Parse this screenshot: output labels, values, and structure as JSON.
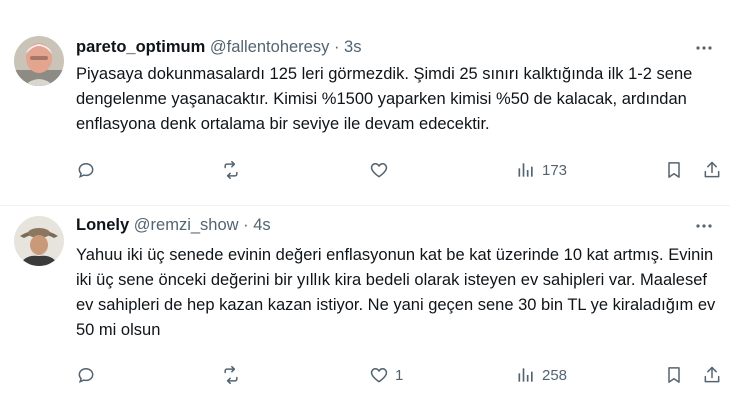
{
  "tweets": [
    {
      "name": "pareto_optimum",
      "handle": "@fallentoheresy",
      "separator": "·",
      "time": "3s",
      "text": "Piyasaya dokunmasalardı 125 leri görmezdik. Şimdi 25 sınırı kalktığında ilk 1-2 sene dengelenme yaşanacaktır. Kimisi %1500 yaparken kimisi %50 de kalacak, ardından enflasyona denk ortalama bir seviye ile devam edecektir.",
      "likes": "",
      "views": "173"
    },
    {
      "name": "Lonely",
      "handle": "@remzi_show",
      "separator": "·",
      "time": "4s",
      "text": "Yahuu iki üç senede evinin değeri enflasyonun kat be kat üzerinde 10 kat artmış. Evinin iki üç sene önceki değerini bir yıllık kira bedeli olarak isteyen ev sahipleri var. Maalesef ev sahipleri de hep kazan kazan istiyor. Ne yani geçen sene 30 bin TL ye kiraladığım ev 50 mi olsun",
      "likes": "1",
      "views": "258"
    }
  ],
  "icons": {
    "reply": "reply-icon",
    "retweet": "retweet-icon",
    "like": "heart-icon",
    "views": "views-icon",
    "bookmark": "bookmark-icon",
    "share": "share-icon",
    "more": "more-icon"
  },
  "colors": {
    "text": "#0f1419",
    "muted": "#536471",
    "divider": "#eff3f4"
  }
}
